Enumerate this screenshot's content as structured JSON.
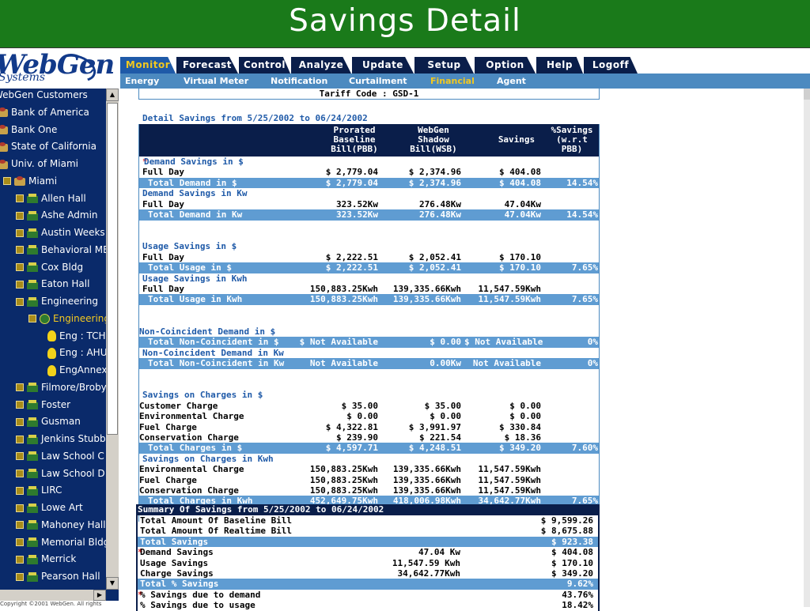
{
  "page": {
    "title": "Savings Detail"
  },
  "logo": {
    "main": "WebGen",
    "sub": "Systems"
  },
  "tabs": [
    {
      "label": "Monitor",
      "active": true
    },
    {
      "label": "Forecast"
    },
    {
      "label": "Control"
    },
    {
      "label": "Analyze"
    },
    {
      "label": "Update"
    },
    {
      "label": "Setup"
    },
    {
      "label": "Option"
    },
    {
      "label": "Help"
    },
    {
      "label": "Logoff"
    }
  ],
  "subnav": [
    {
      "label": "Energy"
    },
    {
      "label": "Virtual Meter"
    },
    {
      "label": "Notification"
    },
    {
      "label": "Curtailment"
    },
    {
      "label": "Financial",
      "active": true
    },
    {
      "label": "Agent"
    }
  ],
  "tree": {
    "items": [
      {
        "label": "WebGen Customers"
      },
      {
        "label": "Bank of America"
      },
      {
        "label": "Bank One"
      },
      {
        "label": "State of California"
      },
      {
        "label": "Univ. of Miami"
      },
      {
        "label": "Miami"
      },
      {
        "label": "Allen Hall"
      },
      {
        "label": "Ashe Admin"
      },
      {
        "label": "Austin Weeks"
      },
      {
        "label": "Behavioral ME"
      },
      {
        "label": "Cox Bldg"
      },
      {
        "label": "Eaton Hall"
      },
      {
        "label": "Engineering"
      },
      {
        "label": "Engineering"
      },
      {
        "label": "Eng : TCH"
      },
      {
        "label": "Eng : AHU"
      },
      {
        "label": "EngAnnex"
      },
      {
        "label": "Filmore/Broby"
      },
      {
        "label": "Foster"
      },
      {
        "label": "Gusman"
      },
      {
        "label": "Jenkins Stubbs"
      },
      {
        "label": "Law School C"
      },
      {
        "label": "Law School D"
      },
      {
        "label": "LIRC"
      },
      {
        "label": "Lowe Art"
      },
      {
        "label": "Mahoney Hall"
      },
      {
        "label": "Memorial Bldg"
      },
      {
        "label": "Merrick"
      },
      {
        "label": "Pearson Hall"
      }
    ],
    "copyright": "Copyright ©2001 WebGen. All rights"
  },
  "detail": {
    "tariff": "Tariff Code :  GSD-1",
    "title": "Detail Savings from 5/25/2002 to 06/24/2002",
    "headers": {
      "pbb": "Prorated Baseline Bill(PBB)",
      "wsb": "WebGen Shadow Bill(WSB)",
      "savings": "Savings",
      "pct": "%Savings (w.r.t PBB)"
    },
    "rows": [
      {
        "label": "Demand Savings in $",
        "type": "section",
        "star": true
      },
      {
        "label": "Full Day",
        "pbb": "$ 2,779.04",
        "wsb": "$ 2,374.96",
        "sav": "$ 404.08"
      },
      {
        "label": "Total Demand in $",
        "type": "total",
        "pbb": "$ 2,779.04",
        "wsb": "$ 2,374.96",
        "sav": "$ 404.08",
        "pct": "14.54%"
      },
      {
        "label": "Demand Savings in Kw",
        "type": "section"
      },
      {
        "label": "Full Day",
        "pbb": "323.52Kw",
        "wsb": "276.48Kw",
        "sav": "47.04Kw"
      },
      {
        "label": "Total Demand in Kw",
        "type": "total",
        "pbb": "323.52Kw",
        "wsb": "276.48Kw",
        "sav": "47.04Kw",
        "pct": "14.54%"
      },
      {
        "label": "",
        "type": "blank"
      },
      {
        "label": "Usage Savings in $",
        "type": "section"
      },
      {
        "label": "Full Day",
        "pbb": "$ 2,222.51",
        "wsb": "$ 2,052.41",
        "sav": "$ 170.10"
      },
      {
        "label": "Total Usage in $",
        "type": "total",
        "pbb": "$ 2,222.51",
        "wsb": "$ 2,052.41",
        "sav": "$ 170.10",
        "pct": "7.65%"
      },
      {
        "label": "Usage Savings in Kwh",
        "type": "section"
      },
      {
        "label": "Full Day",
        "pbb": "150,883.25Kwh",
        "wsb": "139,335.66Kwh",
        "sav": "11,547.59Kwh"
      },
      {
        "label": "Total Usage in Kwh",
        "type": "total",
        "pbb": "150,883.25Kwh",
        "wsb": "139,335.66Kwh",
        "sav": "11,547.59Kwh",
        "pct": "7.65%"
      },
      {
        "label": "",
        "type": "blank"
      },
      {
        "label": "Non-Coincident Demand in $",
        "type": "section",
        "flush": true
      },
      {
        "label": "Total Non-Coincident in $",
        "type": "total",
        "pbb": "$ Not Available",
        "wsb": "$ 0.00",
        "sav": "$ Not Available",
        "pct": "0%"
      },
      {
        "label": "Non-Coincident Demand in Kw",
        "type": "section"
      },
      {
        "label": "Total Non-Coincident in Kw",
        "type": "total",
        "pbb": "Not Available",
        "wsb": "0.00Kw",
        "sav": "Not Available",
        "pct": "0%"
      },
      {
        "label": "",
        "type": "blank"
      },
      {
        "label": "Savings on Charges in $",
        "type": "section"
      },
      {
        "label": "Customer Charge",
        "flush": true,
        "pbb": "$ 35.00",
        "wsb": "$ 35.00",
        "sav": "$ 0.00"
      },
      {
        "label": "Environmental Charge",
        "flush": true,
        "pbb": "$ 0.00",
        "wsb": "$ 0.00",
        "sav": "$ 0.00"
      },
      {
        "label": "Fuel Charge",
        "flush": true,
        "pbb": "$ 4,322.81",
        "wsb": "$ 3,991.97",
        "sav": "$ 330.84"
      },
      {
        "label": "Conservation Charge",
        "flush": true,
        "pbb": "$ 239.90",
        "wsb": "$ 221.54",
        "sav": "$ 18.36"
      },
      {
        "label": "Total Charges in $",
        "type": "total",
        "pbb": "$ 4,597.71",
        "wsb": "$ 4,248.51",
        "sav": "$ 349.20",
        "pct": "7.60%"
      },
      {
        "label": "Savings on Charges in Kwh",
        "type": "section"
      },
      {
        "label": "Environmental Charge",
        "flush": true,
        "pbb": "150,883.25Kwh",
        "wsb": "139,335.66Kwh",
        "sav": "11,547.59Kwh"
      },
      {
        "label": "Fuel Charge",
        "flush": true,
        "pbb": "150,883.25Kwh",
        "wsb": "139,335.66Kwh",
        "sav": "11,547.59Kwh"
      },
      {
        "label": "Conservation Charge",
        "flush": true,
        "pbb": "150,883.25Kwh",
        "wsb": "139,335.66Kwh",
        "sav": "11,547.59Kwh"
      },
      {
        "label": "Total Charges in Kwh",
        "type": "total",
        "pbb": "452,649.75Kwh",
        "wsb": "418,006.98Kwh",
        "sav": "34,642.77Kwh",
        "pct": "7.65%"
      }
    ]
  },
  "summary": {
    "title": "Summary Of Savings from 5/25/2002 to 06/24/2002",
    "rows": [
      {
        "label": "Total Amount Of Baseline Bill",
        "val": "$ 9,599.26"
      },
      {
        "label": "Total Amount Of Realtime Bill",
        "val": "$ 8,675.88"
      },
      {
        "label": "Total Savings",
        "type": "total",
        "val": "$ 923.38"
      },
      {
        "label": "Demand Savings",
        "star": true,
        "mid": "47.04 Kw",
        "val": "$ 404.08"
      },
      {
        "label": "Usage Savings",
        "mid": "11,547.59 Kwh",
        "val": "$ 170.10"
      },
      {
        "label": "Charge Savings",
        "mid": "34,642.77Kwh",
        "val": "$ 349.20"
      },
      {
        "label": "Total % Savings",
        "type": "total",
        "val": "9.62%"
      },
      {
        "label": "% Savings due to demand",
        "star": true,
        "val": "43.76%"
      },
      {
        "label": "% Savings due to usage",
        "val": "18.42%"
      }
    ]
  },
  "colors": {
    "title_green": "#1a7a1a",
    "navy": "#0a1e4a",
    "accent_blue": "#5f9cd2",
    "active_yellow": "#f2c820"
  }
}
